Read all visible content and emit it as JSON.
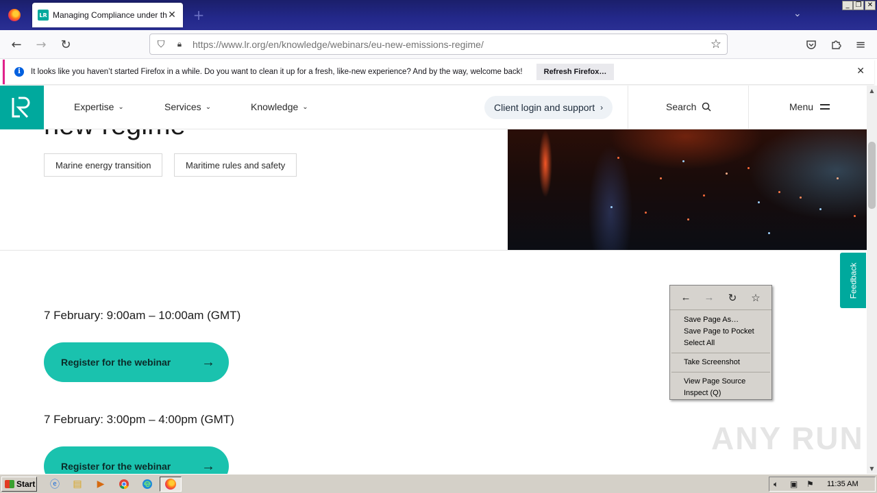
{
  "browser": {
    "tab": {
      "title": "Managing Compliance under the EU",
      "favicon_text": "LR"
    },
    "url": "https://www.lr.org/en/knowledge/webinars/eu-new-emissions-regime/",
    "notification": {
      "message": "It looks like you haven’t started Firefox in a while. Do you want to clean it up for a fresh, like-new experience? And by the way, welcome back!",
      "button": "Refresh Firefox…"
    }
  },
  "site": {
    "logo_text": "LR",
    "nav": [
      {
        "label": "Expertise"
      },
      {
        "label": "Services"
      },
      {
        "label": "Knowledge"
      }
    ],
    "client_login": "Client login and support",
    "search": "Search",
    "menu": "Menu",
    "hero_title_fragment": "new regime",
    "tags": [
      "Marine energy transition",
      "Maritime rules and safety"
    ],
    "sessions": [
      {
        "time": "7 February: 9:00am – 10:00am (GMT)",
        "button": "Register for the webinar"
      },
      {
        "time": "7 February: 3:00pm – 4:00pm (GMT)",
        "button": "Register for the webinar"
      }
    ],
    "feedback": "Feedback"
  },
  "context_menu": {
    "items_group1": [
      "Save Page As…",
      "Save Page to Pocket",
      "Select All"
    ],
    "items_group2": [
      "Take Screenshot"
    ],
    "items_group3": [
      "View Page Source",
      "Inspect (Q)"
    ]
  },
  "watermark": "ANY RUN",
  "taskbar": {
    "start": "Start",
    "clock": "11:35 AM"
  },
  "colors": {
    "brand_teal": "#00a99d",
    "register_button": "#1ac2ae",
    "notification_accent": "#e1218b"
  }
}
